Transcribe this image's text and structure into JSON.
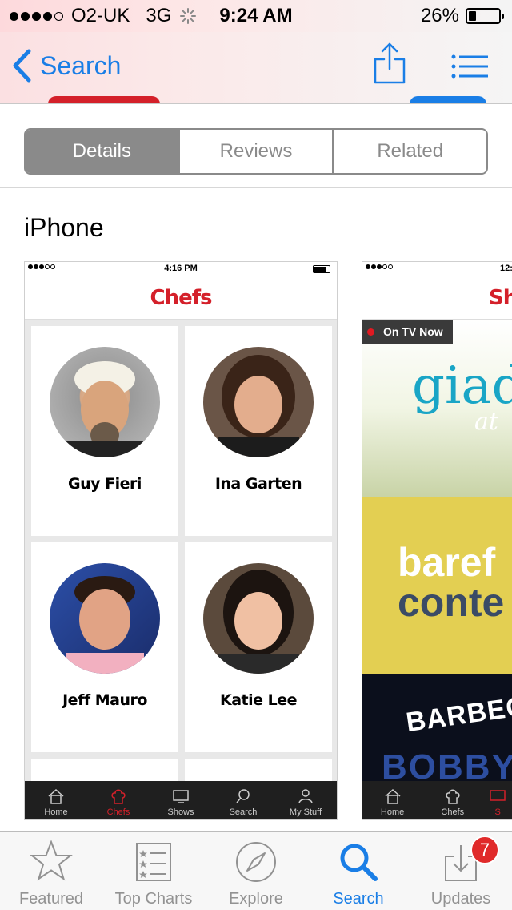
{
  "status_bar": {
    "carrier": "O2-UK",
    "network": "3G",
    "time": "9:24 AM",
    "battery_percent": "26%",
    "battery_level": 0.26,
    "signal_bars_filled": 4,
    "signal_bars_total": 5
  },
  "nav": {
    "back_label": "Search",
    "share_icon": "share-icon",
    "list_icon": "list-icon"
  },
  "segments": [
    {
      "label": "Details",
      "active": true
    },
    {
      "label": "Reviews",
      "active": false
    },
    {
      "label": "Related",
      "active": false
    }
  ],
  "section_title": "iPhone",
  "screenshot1": {
    "time": "4:16 PM",
    "header": "Chefs",
    "chefs": [
      {
        "name": "Guy Fieri"
      },
      {
        "name": "Ina Garten"
      },
      {
        "name": "Jeff Mauro"
      },
      {
        "name": "Katie Lee"
      }
    ],
    "tabs": [
      "Home",
      "Chefs",
      "Shows",
      "Search",
      "My Stuff"
    ],
    "active_tab": "Chefs"
  },
  "screenshot2": {
    "time": "12:",
    "header": "Sh",
    "on_tv_label": "On TV Now",
    "promo_texts": [
      "giad",
      "at",
      "baref",
      "conte",
      "BARBECU",
      "BOBBY"
    ],
    "tabs": [
      "Home",
      "Chefs",
      "S"
    ]
  },
  "tab_bar": {
    "items": [
      {
        "label": "Featured",
        "icon": "star-icon",
        "active": false
      },
      {
        "label": "Top Charts",
        "icon": "list-icon",
        "active": false
      },
      {
        "label": "Explore",
        "icon": "compass-icon",
        "active": false
      },
      {
        "label": "Search",
        "icon": "search-icon",
        "active": true
      },
      {
        "label": "Updates",
        "icon": "download-icon",
        "active": false
      }
    ],
    "updates_badge": "7"
  },
  "colors": {
    "accent": "#1a7ee6",
    "brand_red": "#d4202a",
    "segment_gray": "#8a8a8a",
    "badge_red": "#e02a2a"
  }
}
